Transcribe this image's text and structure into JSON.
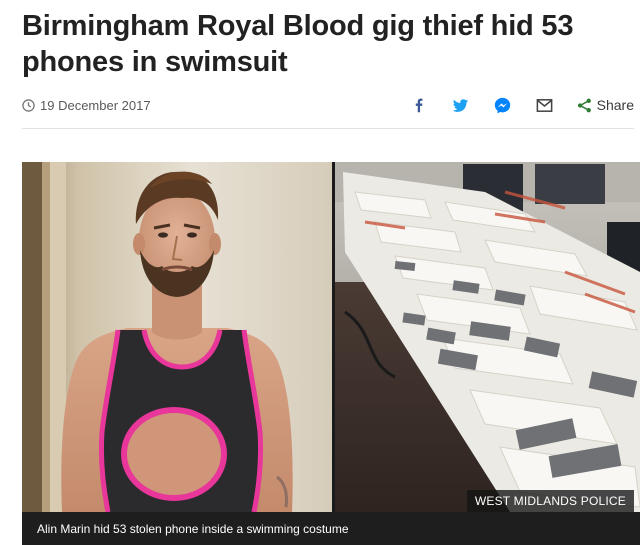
{
  "article": {
    "headline": "Birmingham Royal Blood gig thief hid 53 phones in swimsuit",
    "date": "19 December 2017"
  },
  "share": {
    "label": "Share",
    "icons": [
      "facebook-icon",
      "twitter-icon",
      "messenger-icon",
      "email-icon",
      "share-icon"
    ]
  },
  "image": {
    "credit": "WEST MIDLANDS POLICE",
    "caption": "Alin Marin hid 53 stolen phone inside a swimming costume"
  },
  "colors": {
    "facebook": "#3b5998",
    "twitter": "#1da1f2",
    "messenger": "#0084ff",
    "share_green": "#2e7d32",
    "swimsuit_trim": "#e8369a",
    "swimsuit_body": "#2b2b2e"
  }
}
